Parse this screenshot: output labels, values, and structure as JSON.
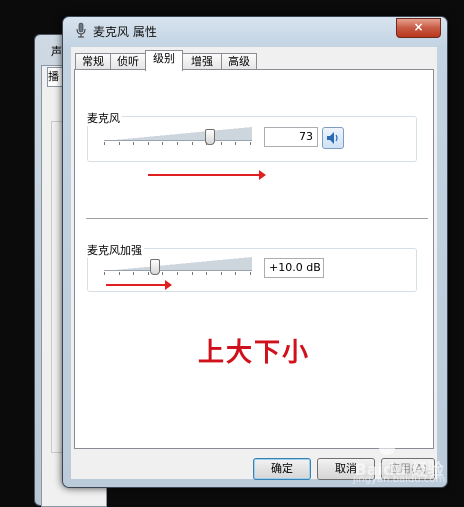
{
  "background_window": {
    "title_fragment": "声",
    "tab_fragment": "播"
  },
  "dialog": {
    "title": "麦克风 属性",
    "close_glyph": "×",
    "tabs": [
      {
        "label": "常规",
        "active": false
      },
      {
        "label": "侦听",
        "active": false
      },
      {
        "label": "级别",
        "active": true
      },
      {
        "label": "增强",
        "active": false
      },
      {
        "label": "高级",
        "active": false
      }
    ],
    "microphone": {
      "label": "麦克风",
      "value": "73",
      "level_percent": 73,
      "speaker_icon": "speaker-icon"
    },
    "boost": {
      "label": "麦克风加强",
      "value": "+10.0 dB",
      "level_fraction": 0.33
    },
    "annotation_text": "上大下小",
    "annotation_color": "#d0101a",
    "buttons": {
      "ok": "确定",
      "cancel": "取消",
      "apply": "应用(A)"
    }
  },
  "watermark": {
    "brand": "Baidu 经验",
    "sub": "jingyan.baidu.com"
  }
}
